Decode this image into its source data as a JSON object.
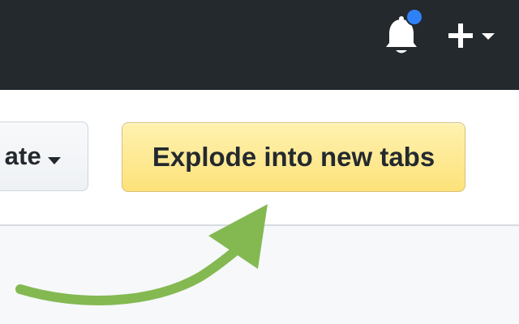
{
  "header": {
    "notification_icon": "bell-icon",
    "notification_dot_color": "#2f81f7",
    "create_icon": "plus-icon",
    "dropdown_icon": "caret-down-icon"
  },
  "toolbar": {
    "left_button_label": "ate",
    "left_button_icon": "caret-down-icon",
    "explode_button_label": "Explode into new tabs"
  },
  "arrow": {
    "icon": "curved-arrow-icon",
    "color": "#84b952"
  },
  "colors": {
    "header_background": "#24292e",
    "content_background": "#ffffff",
    "lower_background": "#f6f8fa",
    "explode_button_background": "#fde27a",
    "text": "#24292e"
  }
}
